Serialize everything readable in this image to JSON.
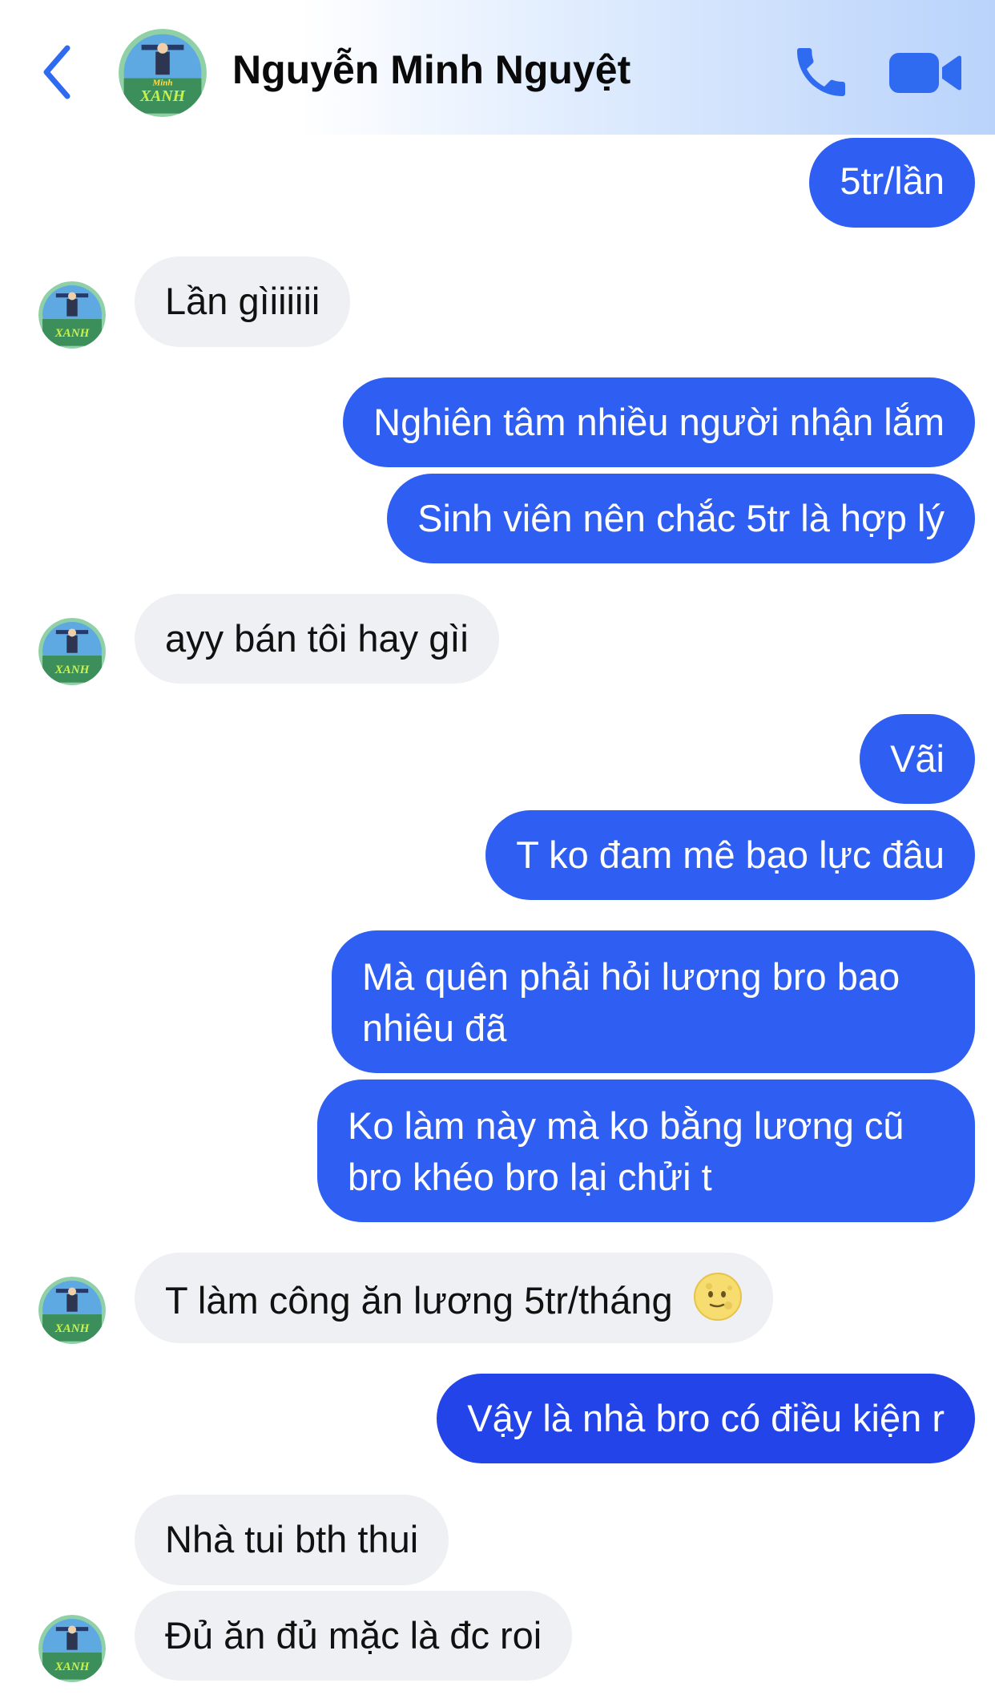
{
  "header": {
    "contact_name": "Nguyễn Minh Nguyệt",
    "icons": {
      "back": "chevron-left-icon",
      "call": "phone-icon",
      "video": "video-camera-icon"
    }
  },
  "avatar_logo_text": {
    "top": "Minh",
    "bottom": "XANH"
  },
  "colors": {
    "outgoing_bubble": "#2f5ff2",
    "incoming_bubble": "#eff0f3",
    "accent": "#2f6bf0"
  },
  "messages": [
    {
      "from": "me",
      "text": "5tr/lần"
    },
    {
      "from": "contact",
      "text": "Lần gìiiiiii"
    },
    {
      "from": "me",
      "text": "Nghiên tâm nhiều người nhận lắm"
    },
    {
      "from": "me",
      "text": "Sinh viên nên chắc 5tr là hợp lý"
    },
    {
      "from": "contact",
      "text": "ayy bán tôi hay gìi"
    },
    {
      "from": "me",
      "text": "Vãi"
    },
    {
      "from": "me",
      "text": "T ko đam mê bạo lực đâu"
    },
    {
      "from": "me",
      "text": "Mà quên phải hỏi lương bro bao nhiêu đã"
    },
    {
      "from": "me",
      "text": "Ko làm này mà ko bằng lương cũ bro khéo bro lại chửi t"
    },
    {
      "from": "contact",
      "text": "T làm công ăn lương 5tr/tháng",
      "emoji": "full-moon-face-emoji"
    },
    {
      "from": "me",
      "text": "Vậy là nhà bro có điều kiện r"
    },
    {
      "from": "contact",
      "text": "Nhà tui bth thui"
    },
    {
      "from": "contact",
      "text": "Đủ ăn đủ mặc là đc roi"
    }
  ]
}
